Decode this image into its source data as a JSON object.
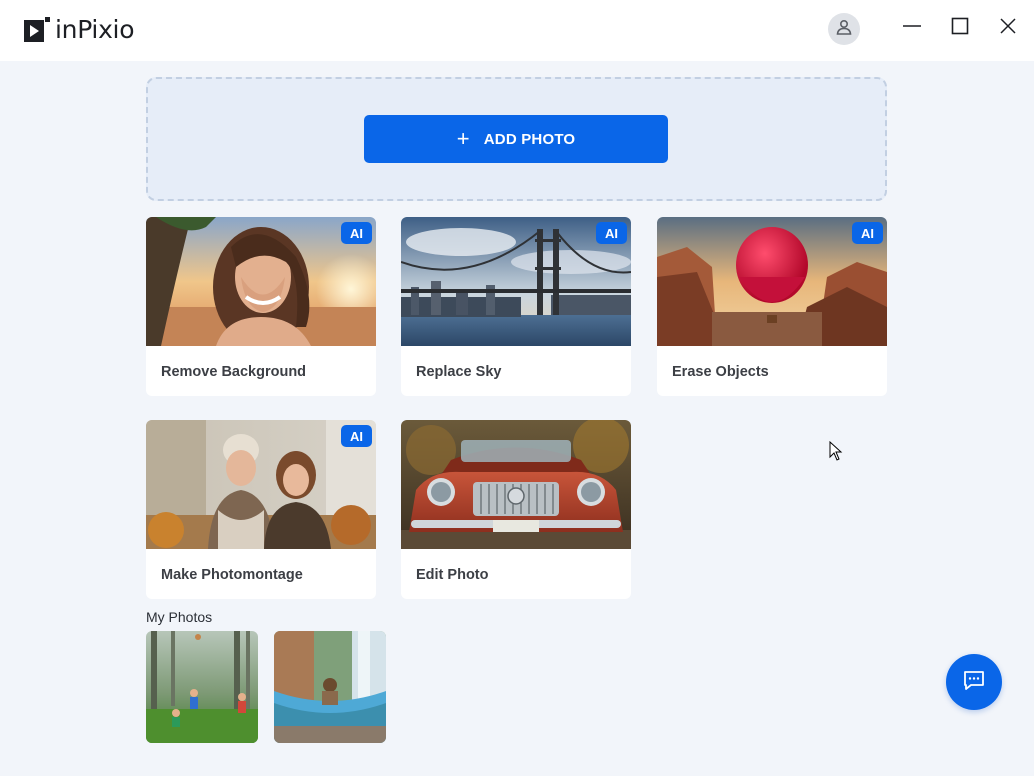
{
  "app": {
    "brand": "inPixio",
    "colors": {
      "accent": "#0a66e8",
      "background": "#f2f5fa",
      "card": "#ffffff",
      "dropzone": "#e6edf8"
    }
  },
  "titlebar": {
    "icons": [
      "user-icon",
      "minimize-icon",
      "maximize-icon",
      "close-icon"
    ]
  },
  "dropzone": {
    "add_photo_label": "ADD PHOTO",
    "add_icon": "+"
  },
  "cards": [
    {
      "label": "Remove Background",
      "badge": "AI",
      "image": "portrait-woman-sunset"
    },
    {
      "label": "Replace Sky",
      "badge": "AI",
      "image": "bridge-city-sky"
    },
    {
      "label": "Erase Objects",
      "badge": "AI",
      "image": "hot-air-balloon-canyon"
    },
    {
      "label": "Make Photomontage",
      "badge": "AI",
      "image": "two-women-laughing"
    },
    {
      "label": "Edit Photo",
      "badge": "",
      "image": "vintage-red-car"
    }
  ],
  "my_photos": {
    "title": "My Photos",
    "items": [
      {
        "image": "kids-playing-forest"
      },
      {
        "image": "hammock-waterfall"
      }
    ]
  },
  "chat": {
    "icon": "chat-icon"
  }
}
